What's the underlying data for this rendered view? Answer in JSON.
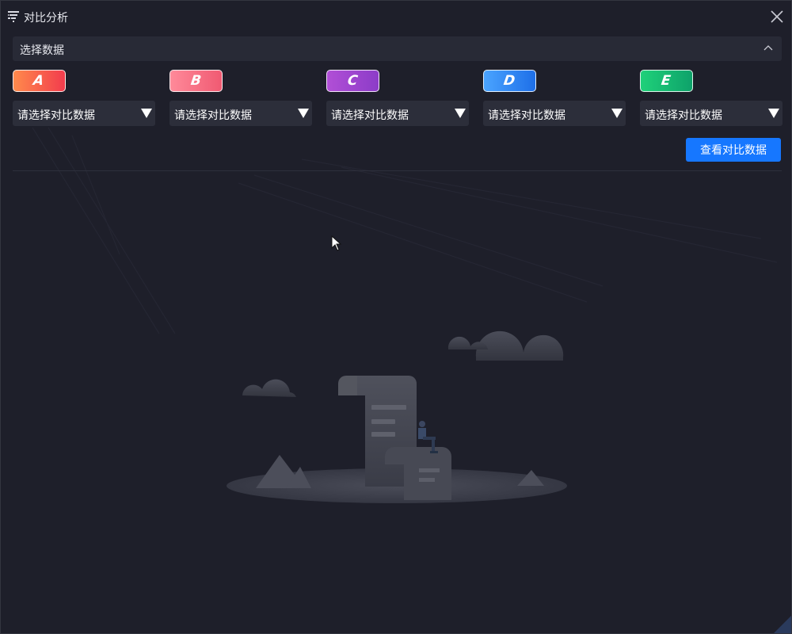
{
  "window": {
    "title": "对比分析",
    "title_icon": "funnel-list-icon",
    "close_icon": "close-icon"
  },
  "section": {
    "title": "选择数据",
    "collapse_icon": "chevron-up-icon"
  },
  "slots": [
    {
      "label": "A",
      "select_text": "请选择对比数据",
      "color_from": "#ff8a4c",
      "color_to": "#f23c4d"
    },
    {
      "label": "B",
      "select_text": "请选择对比数据",
      "color_from": "#ff8a9a",
      "color_to": "#f05a72"
    },
    {
      "label": "C",
      "select_text": "请选择对比数据",
      "color_from": "#b14fd6",
      "color_to": "#8c3cc8"
    },
    {
      "label": "D",
      "select_text": "请选择对比数据",
      "color_from": "#4aa4ff",
      "color_to": "#1e6fe8"
    },
    {
      "label": "E",
      "select_text": "请选择对比数据",
      "color_from": "#1fd17a",
      "color_to": "#0ea26a"
    }
  ],
  "actions": {
    "view_label": "查看对比数据"
  },
  "colors": {
    "background": "#1e1f2a",
    "panel": "#282a36",
    "select_bg": "#2c2e3a",
    "primary": "#1677ff"
  }
}
